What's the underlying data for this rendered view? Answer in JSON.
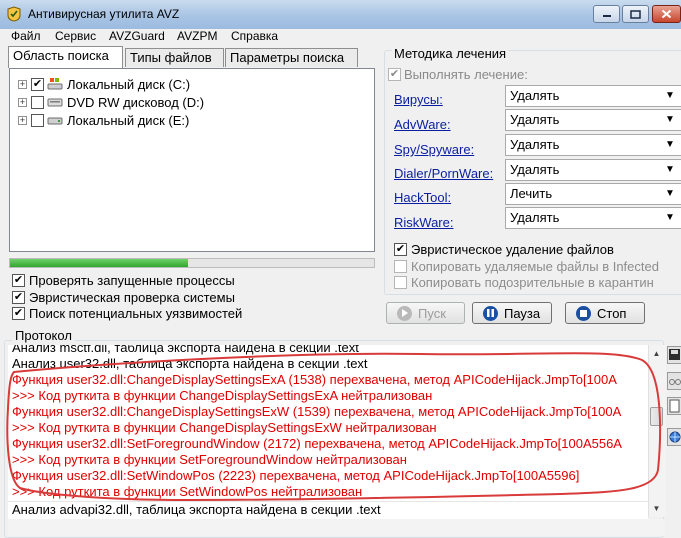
{
  "window": {
    "title": "Антивирусная утилита AVZ",
    "controls": [
      "minimize",
      "maximize",
      "close"
    ]
  },
  "menu": [
    "Файл",
    "Сервис",
    "AVZGuard",
    "AVZPM",
    "Справка"
  ],
  "tabs": [
    {
      "label": "Область поиска",
      "active": true
    },
    {
      "label": "Типы файлов",
      "active": false
    },
    {
      "label": "Параметры поиска",
      "active": false
    }
  ],
  "drives": [
    {
      "label": "Локальный диск (C:)",
      "checked": true
    },
    {
      "label": "DVD RW дисковод (D:)",
      "checked": false
    },
    {
      "label": "Локальный диск (E:)",
      "checked": false
    }
  ],
  "progress": {
    "fraction": 0.49,
    "color": "#3cbf37"
  },
  "scan_options": [
    {
      "label": "Проверять запущенные процессы",
      "checked": true
    },
    {
      "label": "Эвристическая проверка системы",
      "checked": true
    },
    {
      "label": "Поиск потенциальных уязвимостей",
      "checked": true
    }
  ],
  "treatment": {
    "legend": "Методика лечения",
    "perform_label": "Выполнять лечение:",
    "perform_checked": true,
    "rows": [
      {
        "threat": "Вирусы:",
        "action": "Удалять"
      },
      {
        "threat": "AdvWare:",
        "action": "Удалять"
      },
      {
        "threat": "Spy/Spyware:",
        "action": "Удалять"
      },
      {
        "threat": "Dialer/PornWare:",
        "action": "Удалять"
      },
      {
        "threat": "HackTool:",
        "action": "Лечить"
      },
      {
        "threat": "RiskWare:",
        "action": "Удалять"
      }
    ],
    "options": [
      {
        "label": "Эвристическое удаление файлов",
        "checked": true,
        "enabled": true
      },
      {
        "label": "Копировать удаляемые файлы в  Infected",
        "checked": false,
        "enabled": false
      },
      {
        "label": "Копировать подозрительные в  карантин",
        "checked": false,
        "enabled": false
      }
    ]
  },
  "buttons": {
    "start": "Пуск",
    "pause": "Пауза",
    "stop": "Стоп"
  },
  "protocol": {
    "legend": "Протокол",
    "lines": [
      {
        "text": "Анализ msctf.dll, таблица экспорта найдена в секции .text",
        "warn": false
      },
      {
        "text": "Анализ user32.dll, таблица экспорта найдена в секции .text",
        "warn": false
      },
      {
        "text": "Функция user32.dll:ChangeDisplaySettingsExA (1538) перехвачена, метод APICodeHijack.JmpTo[100A",
        "warn": true
      },
      {
        "text": ">>> Код руткита в функции ChangeDisplaySettingsExA нейтрализован",
        "warn": true
      },
      {
        "text": "Функция user32.dll:ChangeDisplaySettingsExW (1539) перехвачена, метод APICodeHijack.JmpTo[100A",
        "warn": true
      },
      {
        "text": ">>> Код руткита в функции ChangeDisplaySettingsExW нейтрализован",
        "warn": true
      },
      {
        "text": "Функция user32.dll:SetForegroundWindow (2172) перехвачена, метод APICodeHijack.JmpTo[100A556A",
        "warn": true
      },
      {
        "text": ">>> Код руткита в функции SetForegroundWindow нейтрализован",
        "warn": true
      },
      {
        "text": "Функция user32.dll:SetWindowPos (2223) перехвачена, метод APICodeHijack.JmpTo[100A5596]",
        "warn": true
      },
      {
        "text": ">>> Код руткита в функции SetWindowPos нейтрализован",
        "warn": true
      }
    ],
    "input_text": "Анализ advapi32.dll, таблица экспорта найдена в секции .text",
    "warn_color": "#e00000",
    "annotation_color": "#d93a3a"
  }
}
